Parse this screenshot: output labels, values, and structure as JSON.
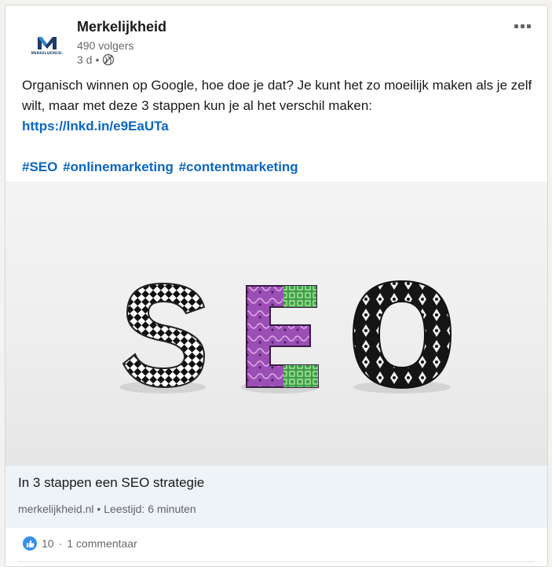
{
  "post": {
    "company": "Merkelijkheid",
    "logo_text": "MERKELIJKHEID.",
    "followers": "490 volgers",
    "time": "3 d",
    "separator": "•",
    "text": "Organisch winnen op Google, hoe doe je dat? Je kunt het zo moeilijk maken als je zelf wilt, maar met deze 3 stappen kun je al het verschil maken:",
    "link": "https://lnkd.in/e9EaUTa",
    "hashtags": [
      "#SEO",
      "#onlinemarketing",
      "#contentmarketing"
    ]
  },
  "image": {
    "letters": "SEO"
  },
  "article": {
    "title": "In 3 stappen een SEO strategie",
    "domain": "merkelijkheid.nl",
    "separator": "•",
    "read_time": "Leestijd: 6 minuten"
  },
  "social": {
    "likes": "10",
    "separator": "·",
    "comments": "1 commentaar"
  },
  "icons": {
    "more": "more-horizontal-icon",
    "visibility": "globe-icon",
    "reaction": "like-icon"
  },
  "colors": {
    "link": "#0a66c2",
    "like": "#378fe9",
    "article_bg": "#eef3f8"
  }
}
